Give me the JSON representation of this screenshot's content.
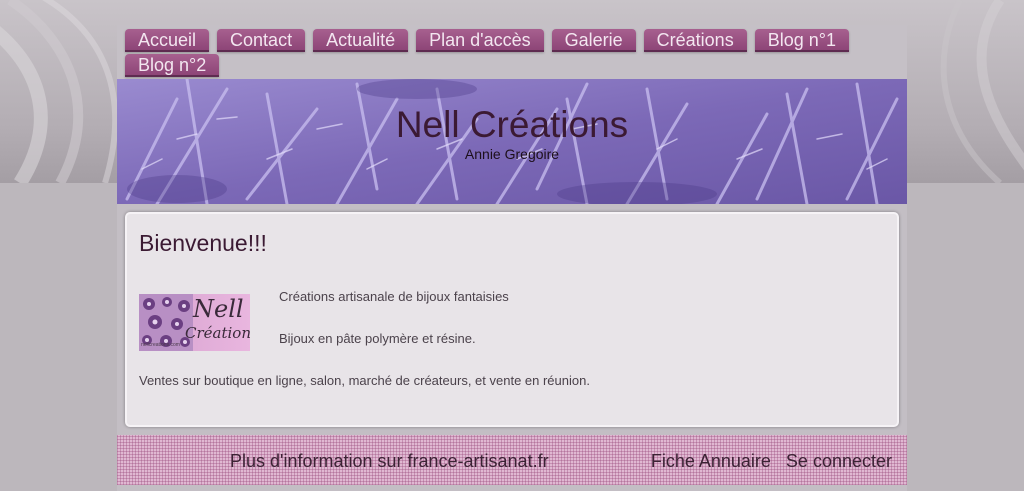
{
  "nav": {
    "items": [
      "Accueil",
      "Contact",
      "Actualité",
      "Plan d'accès",
      "Galerie",
      "Créations",
      "Blog n°1",
      "Blog n°2"
    ]
  },
  "banner": {
    "title": "Nell Créations",
    "subtitle": "Annie Gregoire"
  },
  "content": {
    "title": "Bienvenue!!!",
    "logo": {
      "line1": "Nell",
      "line2": "Créations",
      "url": "nellcreations.com"
    },
    "line1": "Créations artisanale de bijoux fantaisies",
    "line2": "Bijoux en pâte polymère et résine.",
    "line3": "Ventes sur boutique en ligne, salon, marché de créateurs, et vente en réunion."
  },
  "footer": {
    "info": "Plus d'information sur france-artisanat.fr",
    "annuaire": "Fiche Annuaire",
    "login": "Se connecter"
  },
  "colors": {
    "nav_tab": "#9a5284",
    "banner": "#8a79c0",
    "footer": "#e0b8d2",
    "title_text": "#3b1a33"
  }
}
